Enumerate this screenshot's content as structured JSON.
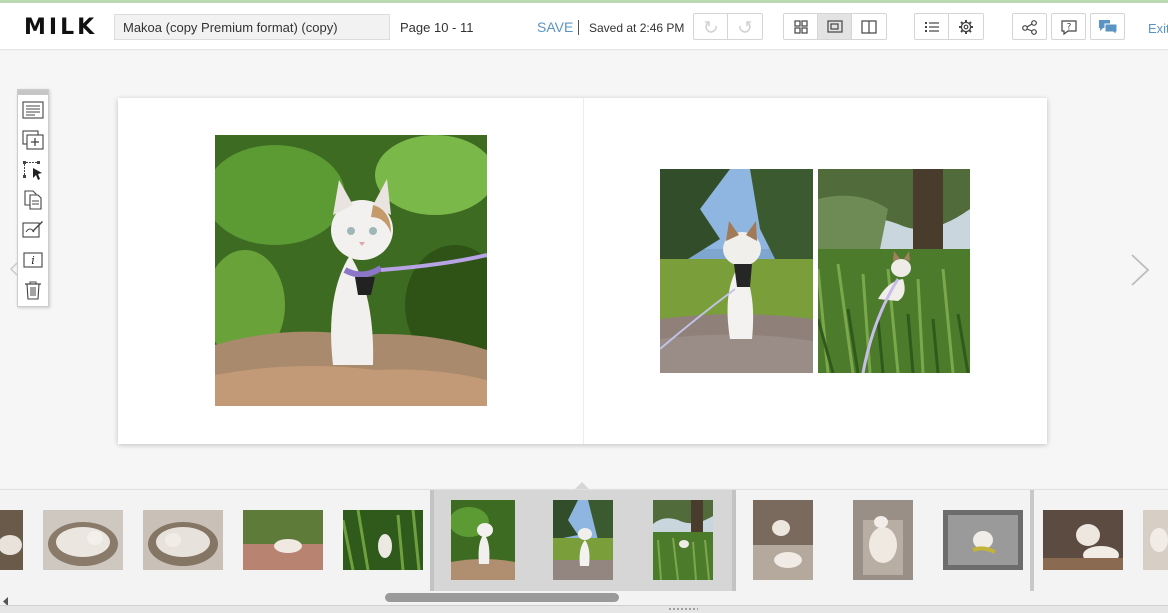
{
  "app": {
    "logo": "MILK"
  },
  "header": {
    "project_title": "Makoa (copy Premium format) (copy)",
    "page_indicator": "Page 10 - 11",
    "save_label": "SAVE",
    "saved_status": "Saved at 2:46 PM",
    "exit_label": "Exit"
  },
  "icons": {
    "undo": "undo-icon",
    "redo": "redo-icon",
    "grid_view": "grid-view-icon",
    "spread_view": "spread-view-icon",
    "page_view": "page-view-icon",
    "list": "list-icon",
    "settings": "gear-icon",
    "share": "share-icon",
    "help": "help-icon",
    "comments": "comments-icon"
  },
  "toolbar_tools": [
    "text-tool-icon",
    "add-frame-icon",
    "select-tool-icon",
    "copy-icon",
    "edit-frame-icon",
    "info-icon",
    "trash-icon"
  ],
  "editor": {
    "view_mode": "spread"
  },
  "colors": {
    "accent": "#5a94c4",
    "top_line": "#b9d9b0",
    "active_spread": "#d6d6d6"
  },
  "scroll": {
    "start_fraction": 0.33,
    "visible_fraction": 0.2
  }
}
